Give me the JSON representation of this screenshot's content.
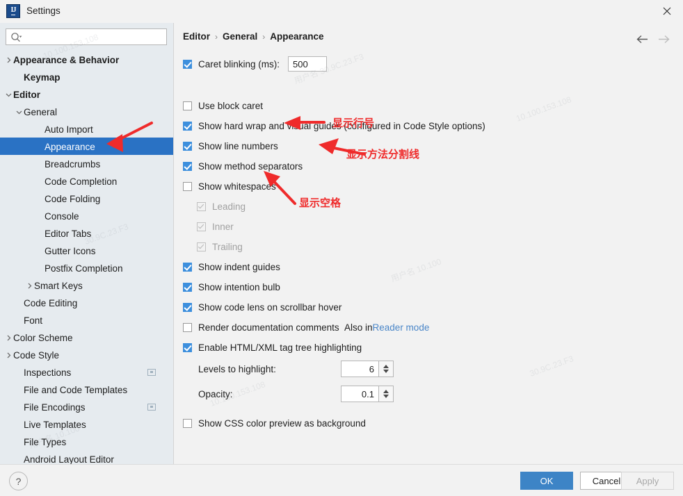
{
  "window": {
    "title": "Settings",
    "app_icon": "intellij-idea-icon",
    "close_icon": "close-icon"
  },
  "search": {
    "value": "",
    "placeholder": "",
    "icon": "search-icon"
  },
  "sidebar": {
    "items": [
      {
        "label": "Appearance & Behavior",
        "indent": 0,
        "arrow": "right",
        "bold": true,
        "selected": false,
        "badge": false
      },
      {
        "label": "Keymap",
        "indent": 1,
        "arrow": "none",
        "bold": true,
        "selected": false,
        "badge": false
      },
      {
        "label": "Editor",
        "indent": 0,
        "arrow": "down",
        "bold": true,
        "selected": false,
        "badge": false
      },
      {
        "label": "General",
        "indent": 1,
        "arrow": "down",
        "bold": false,
        "selected": false,
        "badge": false
      },
      {
        "label": "Auto Import",
        "indent": 3,
        "arrow": "none",
        "bold": false,
        "selected": false,
        "badge": false
      },
      {
        "label": "Appearance",
        "indent": 3,
        "arrow": "none",
        "bold": false,
        "selected": true,
        "badge": false
      },
      {
        "label": "Breadcrumbs",
        "indent": 3,
        "arrow": "none",
        "bold": false,
        "selected": false,
        "badge": false
      },
      {
        "label": "Code Completion",
        "indent": 3,
        "arrow": "none",
        "bold": false,
        "selected": false,
        "badge": false
      },
      {
        "label": "Code Folding",
        "indent": 3,
        "arrow": "none",
        "bold": false,
        "selected": false,
        "badge": false
      },
      {
        "label": "Console",
        "indent": 3,
        "arrow": "none",
        "bold": false,
        "selected": false,
        "badge": false
      },
      {
        "label": "Editor Tabs",
        "indent": 3,
        "arrow": "none",
        "bold": false,
        "selected": false,
        "badge": false
      },
      {
        "label": "Gutter Icons",
        "indent": 3,
        "arrow": "none",
        "bold": false,
        "selected": false,
        "badge": false
      },
      {
        "label": "Postfix Completion",
        "indent": 3,
        "arrow": "none",
        "bold": false,
        "selected": false,
        "badge": false
      },
      {
        "label": "Smart Keys",
        "indent": 2,
        "arrow": "right",
        "bold": false,
        "selected": false,
        "badge": false
      },
      {
        "label": "Code Editing",
        "indent": 1,
        "arrow": "none",
        "bold": false,
        "selected": false,
        "badge": false
      },
      {
        "label": "Font",
        "indent": 1,
        "arrow": "none",
        "bold": false,
        "selected": false,
        "badge": false
      },
      {
        "label": "Color Scheme",
        "indent": 0,
        "arrow": "right",
        "bold": false,
        "selected": false,
        "badge": false
      },
      {
        "label": "Code Style",
        "indent": 0,
        "arrow": "right",
        "bold": false,
        "selected": false,
        "badge": false
      },
      {
        "label": "Inspections",
        "indent": 1,
        "arrow": "none",
        "bold": false,
        "selected": false,
        "badge": true
      },
      {
        "label": "File and Code Templates",
        "indent": 1,
        "arrow": "none",
        "bold": false,
        "selected": false,
        "badge": false
      },
      {
        "label": "File Encodings",
        "indent": 1,
        "arrow": "none",
        "bold": false,
        "selected": false,
        "badge": true
      },
      {
        "label": "Live Templates",
        "indent": 1,
        "arrow": "none",
        "bold": false,
        "selected": false,
        "badge": false
      },
      {
        "label": "File Types",
        "indent": 1,
        "arrow": "none",
        "bold": false,
        "selected": false,
        "badge": false
      },
      {
        "label": "Android Layout Editor",
        "indent": 1,
        "arrow": "none",
        "bold": false,
        "selected": false,
        "badge": false
      }
    ]
  },
  "breadcrumb": {
    "parts": [
      "Editor",
      "General",
      "Appearance"
    ],
    "separator": "›"
  },
  "nav": {
    "back_icon": "arrow-left-icon",
    "forward_icon": "arrow-right-icon"
  },
  "options": {
    "caret_blinking": {
      "label": "Caret blinking (ms):",
      "checked": true,
      "value": "500"
    },
    "use_block_caret": {
      "label": "Use block caret",
      "checked": false
    },
    "show_hard_wrap": {
      "label": "Show hard wrap and visual guides (configured in Code Style options)",
      "checked": true
    },
    "show_line_numbers": {
      "label": "Show line numbers",
      "checked": true
    },
    "show_method_separators": {
      "label": "Show method separators",
      "checked": true
    },
    "show_whitespaces": {
      "label": "Show whitespaces",
      "checked": false
    },
    "leading": {
      "label": "Leading",
      "checked": true,
      "disabled": true
    },
    "inner": {
      "label": "Inner",
      "checked": true,
      "disabled": true
    },
    "trailing": {
      "label": "Trailing",
      "checked": true,
      "disabled": true
    },
    "show_indent_guides": {
      "label": "Show indent guides",
      "checked": true
    },
    "show_intention_bulb": {
      "label": "Show intention bulb",
      "checked": true
    },
    "show_code_lens": {
      "label": "Show code lens on scrollbar hover",
      "checked": true
    },
    "render_doc_comments": {
      "label": "Render documentation comments",
      "checked": false,
      "note_prefix": "Also in ",
      "note_link": "Reader mode"
    },
    "enable_tag_tree": {
      "label": "Enable HTML/XML tag tree highlighting",
      "checked": true
    },
    "levels_to_highlight": {
      "label": "Levels to highlight:",
      "value": "6"
    },
    "opacity": {
      "label": "Opacity:",
      "value": "0.1"
    },
    "show_css_color_preview": {
      "label": "Show CSS color preview as background",
      "checked": false
    }
  },
  "annotations": {
    "color": "#ef2b2b",
    "items": [
      {
        "text": "显示行号"
      },
      {
        "text": "显示方法分割线"
      },
      {
        "text": "显示空格"
      }
    ]
  },
  "footer": {
    "help_label": "?",
    "ok_label": "OK",
    "cancel_label": "Cancel",
    "apply_label": "Apply"
  },
  "theme": {
    "selection": "#2a72c4",
    "primary_button": "#3d84c6",
    "checkbox_on": "#3d8fdd",
    "link": "#4a86c8",
    "annotation_red": "#ef2b2b"
  }
}
